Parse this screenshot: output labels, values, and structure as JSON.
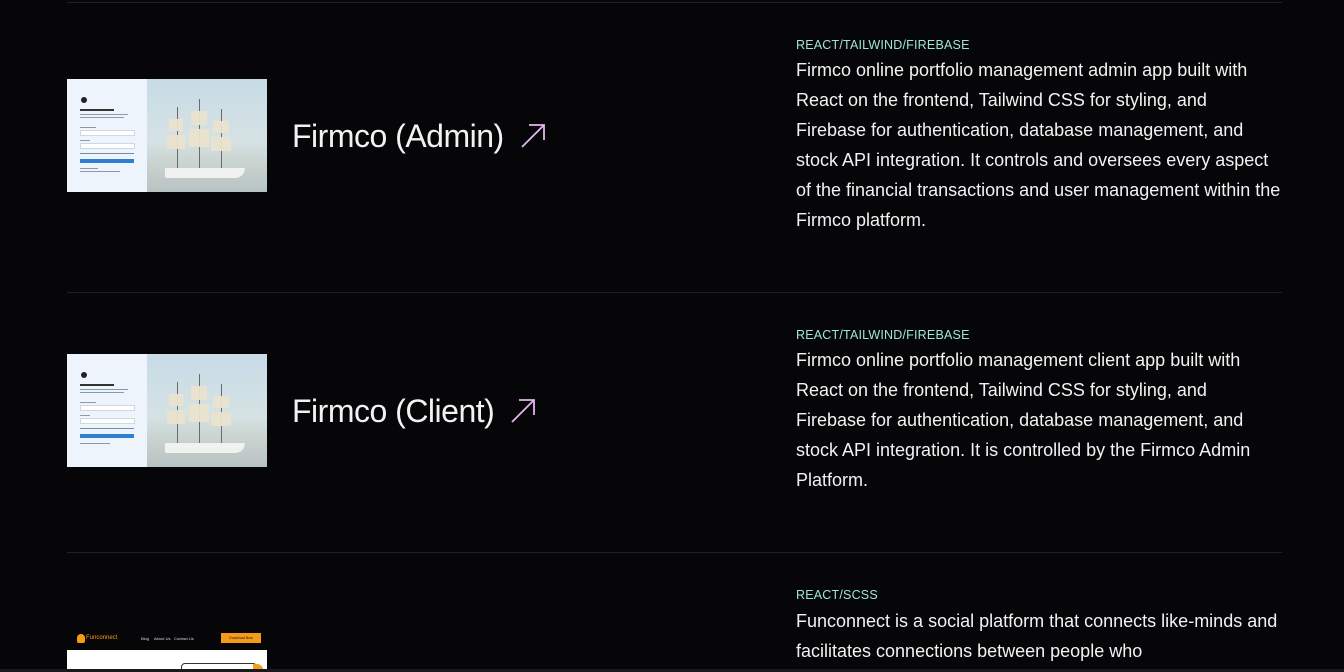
{
  "projects": [
    {
      "title": "Firmco (Admin)",
      "tech": "REACT/TAILWIND/FIREBASE",
      "description": "Firmco online portfolio management admin app built with React on the frontend, Tailwind CSS for styling, and Firebase for authentication, database management, and stock API integration. It controls and oversees every aspect of the financial transactions and user management within the Firmco platform.",
      "arrow_icon": "arrow-up-right-icon"
    },
    {
      "title": "Firmco (Client)",
      "tech": "REACT/TAILWIND/FIREBASE",
      "description": "Firmco online portfolio management client app built with React on the frontend, Tailwind CSS for styling, and Firebase for authentication, database management, and stock API integration. It is controlled by the Firmco Admin Platform.",
      "arrow_icon": "arrow-up-right-icon"
    },
    {
      "title": "",
      "tech": "REACT/SCSS",
      "description": "Funconnect is a social platform that connects like-minds and facilitates connections between people who",
      "thumbnail": {
        "logo_text": "Funconnect",
        "nav_links": [
          "Blog",
          "About Us",
          "Contact Us"
        ],
        "cta": "Download Now"
      }
    }
  ],
  "colors": {
    "background": "#060608",
    "tech_label": "#9fe5d6",
    "arrow": "#e6b6f0",
    "text": "#f2f2f2"
  }
}
